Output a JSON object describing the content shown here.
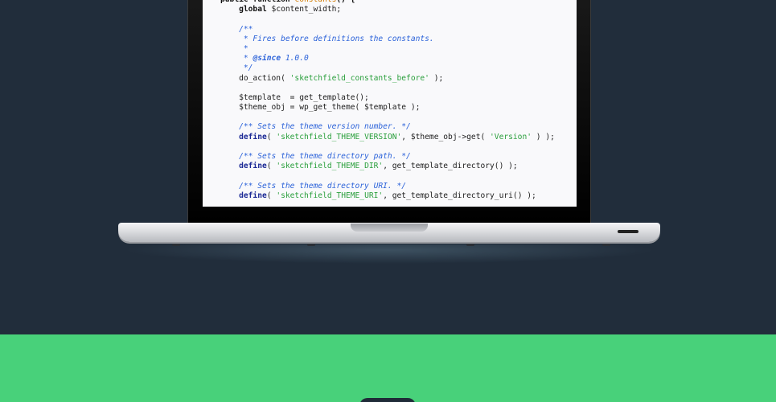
{
  "code_editor": {
    "lines": [
      [
        {
          "t": "public function ",
          "c": "tok-bold"
        },
        {
          "t": "constants",
          "c": "tok-fn"
        },
        {
          "t": "() {",
          "c": "tok-bold"
        }
      ],
      [
        {
          "t": "    global ",
          "c": "tok-bold"
        },
        {
          "t": "$content_width;",
          "c": "tok-pl"
        }
      ],
      [
        {
          "t": "",
          "c": "tok-pl"
        }
      ],
      [
        {
          "t": "    /**",
          "c": "tok-cm"
        }
      ],
      [
        {
          "t": "     * Fires before definitions the constants.",
          "c": "tok-cm"
        }
      ],
      [
        {
          "t": "     *",
          "c": "tok-cm"
        }
      ],
      [
        {
          "t": "     * ",
          "c": "tok-cm"
        },
        {
          "t": "@since",
          "c": "tok-ann"
        },
        {
          "t": " 1.0.0",
          "c": "tok-cm"
        }
      ],
      [
        {
          "t": "     */",
          "c": "tok-cm"
        }
      ],
      [
        {
          "t": "    do_action( ",
          "c": "tok-pl"
        },
        {
          "t": "'sketchfield_constants_before'",
          "c": "tok-str"
        },
        {
          "t": " );",
          "c": "tok-pl"
        }
      ],
      [
        {
          "t": "",
          "c": "tok-pl"
        }
      ],
      [
        {
          "t": "    $template  = get_template();",
          "c": "tok-pl"
        }
      ],
      [
        {
          "t": "    $theme_obj = wp_get_theme( $template );",
          "c": "tok-pl"
        }
      ],
      [
        {
          "t": "",
          "c": "tok-pl"
        }
      ],
      [
        {
          "t": "    /** Sets the theme version number. */",
          "c": "tok-cm"
        }
      ],
      [
        {
          "t": "    define",
          "c": "tok-kw"
        },
        {
          "t": "( ",
          "c": "tok-pl"
        },
        {
          "t": "'sketchfield_THEME_VERSION'",
          "c": "tok-str"
        },
        {
          "t": ", $theme_obj->get( ",
          "c": "tok-pl"
        },
        {
          "t": "'Version'",
          "c": "tok-str"
        },
        {
          "t": " ) );",
          "c": "tok-pl"
        }
      ],
      [
        {
          "t": "",
          "c": "tok-pl"
        }
      ],
      [
        {
          "t": "    /** Sets the theme directory path. */",
          "c": "tok-cm"
        }
      ],
      [
        {
          "t": "    define",
          "c": "tok-kw"
        },
        {
          "t": "( ",
          "c": "tok-pl"
        },
        {
          "t": "'sketchfield_THEME_DIR'",
          "c": "tok-str"
        },
        {
          "t": ", get_template_directory() );",
          "c": "tok-pl"
        }
      ],
      [
        {
          "t": "",
          "c": "tok-pl"
        }
      ],
      [
        {
          "t": "    /** Sets the theme directory URI. */",
          "c": "tok-cm"
        }
      ],
      [
        {
          "t": "    define",
          "c": "tok-kw"
        },
        {
          "t": "( ",
          "c": "tok-pl"
        },
        {
          "t": "'sketchfield_THEME_URI'",
          "c": "tok-str"
        },
        {
          "t": ", get_template_directory_uri() );",
          "c": "tok-pl"
        }
      ]
    ]
  },
  "colors": {
    "dark_background": "#212d3b",
    "accent_green": "#48d17a",
    "code_string": "#2a9f3c",
    "code_comment": "#2b62d9",
    "code_keyword": "#1c2a96",
    "code_function": "#d27b00"
  }
}
